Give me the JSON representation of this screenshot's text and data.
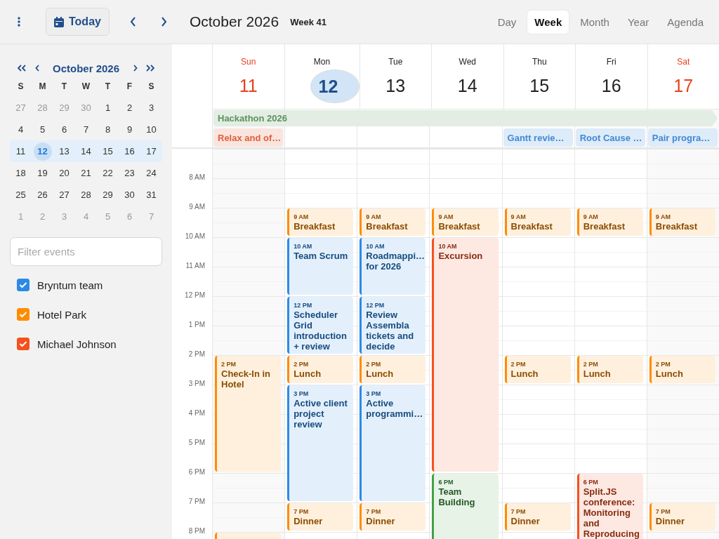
{
  "toolbar": {
    "today_button": "Today",
    "title": "October 2026",
    "week": "Week 41"
  },
  "views": [
    {
      "label": "Day",
      "selected": false
    },
    {
      "label": "Week",
      "selected": true
    },
    {
      "label": "Month",
      "selected": false
    },
    {
      "label": "Year",
      "selected": false
    },
    {
      "label": "Agenda",
      "selected": false
    }
  ],
  "mini_calendar": {
    "title": "October 2026",
    "weekdays": [
      "S",
      "M",
      "T",
      "W",
      "T",
      "F",
      "S"
    ],
    "weeks": [
      {
        "selected": false,
        "days": [
          {
            "label": "27",
            "muted": true,
            "selected": false
          },
          {
            "label": "28",
            "muted": true,
            "selected": false
          },
          {
            "label": "29",
            "muted": true,
            "selected": false
          },
          {
            "label": "30",
            "muted": true,
            "selected": false
          },
          {
            "label": "1",
            "muted": false,
            "selected": false
          },
          {
            "label": "2",
            "muted": false,
            "selected": false
          },
          {
            "label": "3",
            "muted": false,
            "selected": false
          }
        ]
      },
      {
        "selected": false,
        "days": [
          {
            "label": "4",
            "muted": false,
            "selected": false
          },
          {
            "label": "5",
            "muted": false,
            "selected": false
          },
          {
            "label": "6",
            "muted": false,
            "selected": false
          },
          {
            "label": "7",
            "muted": false,
            "selected": false
          },
          {
            "label": "8",
            "muted": false,
            "selected": false
          },
          {
            "label": "9",
            "muted": false,
            "selected": false
          },
          {
            "label": "10",
            "muted": false,
            "selected": false
          }
        ]
      },
      {
        "selected": true,
        "days": [
          {
            "label": "11",
            "muted": false,
            "selected": false
          },
          {
            "label": "12",
            "muted": false,
            "selected": true
          },
          {
            "label": "13",
            "muted": false,
            "selected": false
          },
          {
            "label": "14",
            "muted": false,
            "selected": false
          },
          {
            "label": "15",
            "muted": false,
            "selected": false
          },
          {
            "label": "16",
            "muted": false,
            "selected": false
          },
          {
            "label": "17",
            "muted": false,
            "selected": false
          }
        ]
      },
      {
        "selected": false,
        "days": [
          {
            "label": "18",
            "muted": false,
            "selected": false
          },
          {
            "label": "19",
            "muted": false,
            "selected": false
          },
          {
            "label": "20",
            "muted": false,
            "selected": false
          },
          {
            "label": "21",
            "muted": false,
            "selected": false
          },
          {
            "label": "22",
            "muted": false,
            "selected": false
          },
          {
            "label": "23",
            "muted": false,
            "selected": false
          },
          {
            "label": "24",
            "muted": false,
            "selected": false
          }
        ]
      },
      {
        "selected": false,
        "days": [
          {
            "label": "25",
            "muted": false,
            "selected": false
          },
          {
            "label": "26",
            "muted": false,
            "selected": false
          },
          {
            "label": "27",
            "muted": false,
            "selected": false
          },
          {
            "label": "28",
            "muted": false,
            "selected": false
          },
          {
            "label": "29",
            "muted": false,
            "selected": false
          },
          {
            "label": "30",
            "muted": false,
            "selected": false
          },
          {
            "label": "31",
            "muted": false,
            "selected": false
          }
        ]
      },
      {
        "selected": false,
        "days": [
          {
            "label": "1",
            "muted": true,
            "selected": false
          },
          {
            "label": "2",
            "muted": true,
            "selected": false
          },
          {
            "label": "3",
            "muted": true,
            "selected": false
          },
          {
            "label": "4",
            "muted": true,
            "selected": false
          },
          {
            "label": "5",
            "muted": true,
            "selected": false
          },
          {
            "label": "6",
            "muted": true,
            "selected": false
          },
          {
            "label": "7",
            "muted": true,
            "selected": false
          }
        ]
      }
    ]
  },
  "filter": {
    "placeholder": "Filter events"
  },
  "calendars": [
    {
      "name": "Bryntum team",
      "checked": true,
      "color": "#2b8ae6"
    },
    {
      "name": "Hotel Park",
      "checked": true,
      "color": "#ff8c00"
    },
    {
      "name": "Michael Johnson",
      "checked": true,
      "color": "#f4511e"
    }
  ],
  "days": [
    {
      "name": "Sun",
      "date": "11",
      "weekend": true,
      "today": false,
      "events": [
        {
          "time": "2 PM",
          "title": "Check-In in Hotel",
          "color": "#ff8c00"
        },
        {
          "color": "#ff8c00"
        }
      ]
    },
    {
      "name": "Mon",
      "date": "12",
      "weekend": false,
      "today": true,
      "events": [
        {
          "time": "9 AM",
          "title": "Breakfast",
          "color": "#ff8c00"
        },
        {
          "time": "10 AM",
          "title": "Team Scrum",
          "color": "#2b8ae6"
        },
        {
          "time": "12 PM",
          "title": "Scheduler Grid introduction + review",
          "color": "#2b8ae6"
        },
        {
          "time": "2 PM",
          "title": "Lunch",
          "color": "#ff8c00"
        },
        {
          "time": "3 PM",
          "title": "Active client project review",
          "color": "#2b8ae6"
        },
        {
          "time": "7 PM",
          "title": "Dinner",
          "color": "#ff8c00"
        }
      ]
    },
    {
      "name": "Tue",
      "date": "13",
      "weekend": false,
      "today": false,
      "events": [
        {
          "time": "9 AM",
          "title": "Breakfast",
          "color": "#ff8c00"
        },
        {
          "time": "10 AM",
          "title": "Roadmappi… for 2026",
          "color": "#2b8ae6"
        },
        {
          "time": "12 PM",
          "title": "Review Assembla tickets and decide",
          "color": "#2b8ae6"
        },
        {
          "time": "2 PM",
          "title": "Lunch",
          "color": "#ff8c00"
        },
        {
          "time": "3 PM",
          "title": "Active programmi…",
          "color": "#2b8ae6"
        },
        {
          "time": "7 PM",
          "title": "Dinner",
          "color": "#ff8c00"
        }
      ]
    },
    {
      "name": "Wed",
      "date": "14",
      "weekend": false,
      "today": false,
      "events": [
        {
          "time": "9 AM",
          "title": "Breakfast",
          "color": "#ff8c00"
        },
        {
          "time": "10 AM",
          "title": "Excursion",
          "color": "#f4511e"
        },
        {
          "time": "6 PM",
          "title": "Team Building",
          "color": "#43a047"
        }
      ]
    },
    {
      "name": "Thu",
      "date": "15",
      "weekend": false,
      "today": false,
      "events": [
        {
          "time": "9 AM",
          "title": "Breakfast",
          "color": "#ff8c00"
        },
        {
          "time": "2 PM",
          "title": "Lunch",
          "color": "#ff8c00"
        },
        {
          "time": "7 PM",
          "title": "Dinner",
          "color": "#ff8c00"
        }
      ]
    },
    {
      "name": "Fri",
      "date": "16",
      "weekend": false,
      "today": false,
      "events": [
        {
          "time": "9 AM",
          "title": "Breakfast",
          "color": "#ff8c00"
        },
        {
          "time": "2 PM",
          "title": "Lunch",
          "color": "#ff8c00"
        },
        {
          "time": "6 PM",
          "title": "Split.JS conference: Monitoring and Reproducing",
          "color": "#f4511e"
        }
      ]
    },
    {
      "name": "Sat",
      "date": "17",
      "weekend": true,
      "today": false,
      "events": [
        {
          "time": "9 AM",
          "title": "Breakfast",
          "color": "#ff8c00"
        },
        {
          "time": "2 PM",
          "title": "Lunch",
          "color": "#ff8c00"
        },
        {
          "time": "7 PM",
          "title": "Dinner",
          "color": "#ff8c00"
        }
      ]
    }
  ],
  "all_day_rows": [
    [
      {
        "title": "Hackathon 2026",
        "continues": true,
        "color": "#5a935b"
      }
    ],
    [
      {
        "title": "Relax and of…",
        "continues": false,
        "color": "#e0603c"
      },
      {
        "title": "Gantt revie…",
        "continues": false,
        "color": "#3f8ad6"
      },
      {
        "title": "Root Cause …",
        "continues": false,
        "color": "#3f8ad6"
      },
      {
        "title": "Pair progra…",
        "continues": false,
        "color": "#3f8ad6"
      }
    ]
  ],
  "hour_labels": [
    "8 AM",
    "9 AM",
    "10 AM",
    "11 AM",
    "12 PM",
    "1 PM",
    "2 PM",
    "3 PM",
    "4 PM",
    "5 PM",
    "6 PM",
    "7 PM",
    "8 PM"
  ]
}
